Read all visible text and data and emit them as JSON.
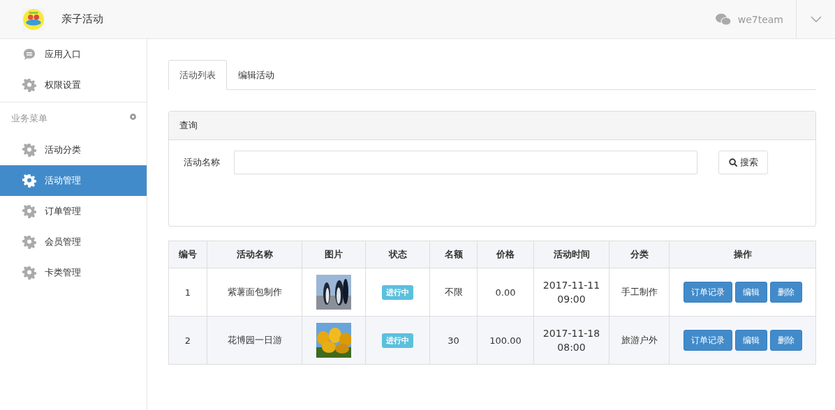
{
  "header": {
    "title": "亲子活动",
    "account": "we7team"
  },
  "sidebar": {
    "top_items": [
      {
        "label": "应用入口",
        "kind": "chat",
        "selected": false
      },
      {
        "label": "权限设置",
        "kind": "gear",
        "selected": false
      }
    ],
    "section_title": "业务菜单",
    "items": [
      {
        "label": "活动分类",
        "kind": "gear",
        "selected": false
      },
      {
        "label": "活动管理",
        "kind": "gear",
        "selected": true
      },
      {
        "label": "订单管理",
        "kind": "gear",
        "selected": false
      },
      {
        "label": "会员管理",
        "kind": "gear",
        "selected": false
      },
      {
        "label": "卡类管理",
        "kind": "gear",
        "selected": false
      }
    ]
  },
  "tabs": [
    {
      "label": "活动列表",
      "selected": true
    },
    {
      "label": "编辑活动",
      "selected": false
    }
  ],
  "search_panel": {
    "title": "查询",
    "field_label": "活动名称",
    "search_button": "搜索"
  },
  "table": {
    "columns": [
      "编号",
      "活动名称",
      "图片",
      "状态",
      "名额",
      "价格",
      "活动时间",
      "分类",
      "操作"
    ],
    "rows": [
      {
        "id": "1",
        "name": "紫薯面包制作",
        "status": "进行中",
        "quota": "不限",
        "price": "0.00",
        "date": "2017-11-11",
        "time": "09:00",
        "category": "手工制作",
        "actions": [
          "订单记录",
          "编辑",
          "删除"
        ]
      },
      {
        "id": "2",
        "name": "花博园一日游",
        "status": "进行中",
        "quota": "30",
        "price": "100.00",
        "date": "2017-11-18",
        "time": "08:00",
        "category": "旅游户外",
        "actions": [
          "订单记录",
          "编辑",
          "删除"
        ]
      }
    ]
  }
}
